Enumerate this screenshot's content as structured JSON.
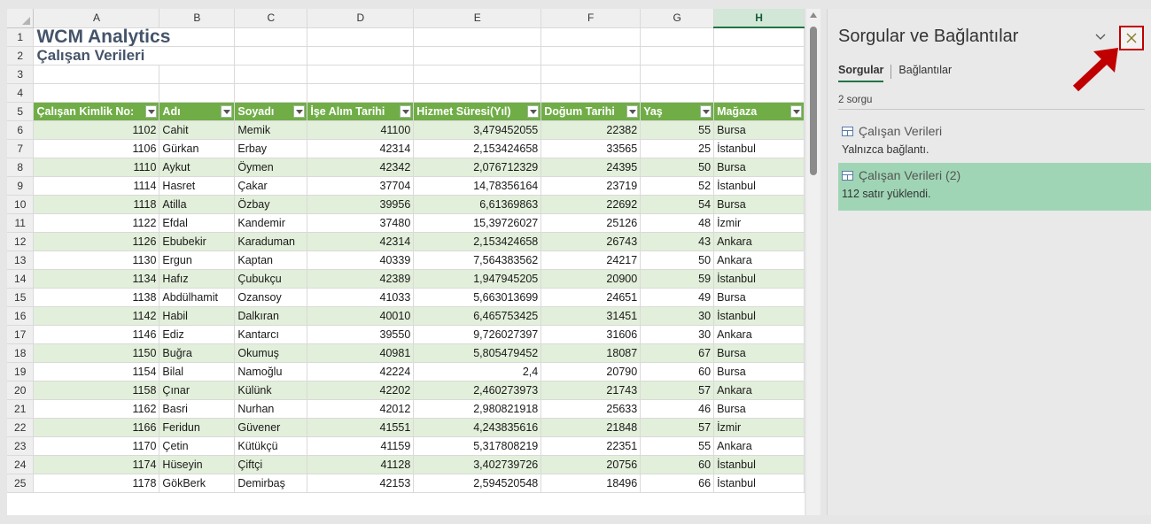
{
  "sheet": {
    "columns": [
      "A",
      "B",
      "C",
      "D",
      "E",
      "F",
      "G",
      "H"
    ],
    "selected_column": "H",
    "title": "WCM Analytics",
    "subtitle": "Çalışan Verileri",
    "headers": [
      "Çalışan Kimlik No:",
      "Adı",
      "Soyadı",
      "İşe Alım Tarihi",
      "Hizmet Süresi(Yıl)",
      "Doğum Tarihi",
      "Yaş",
      "Mağaza"
    ],
    "rows": [
      {
        "n": "6",
        "cells": [
          "1102",
          "Cahit",
          "Memik",
          "41100",
          "3,479452055",
          "22382",
          "55",
          "Bursa"
        ]
      },
      {
        "n": "7",
        "cells": [
          "1106",
          "Gürkan",
          "Erbay",
          "42314",
          "2,153424658",
          "33565",
          "25",
          "İstanbul"
        ]
      },
      {
        "n": "8",
        "cells": [
          "1110",
          "Aykut",
          "Öymen",
          "42342",
          "2,076712329",
          "24395",
          "50",
          "Bursa"
        ]
      },
      {
        "n": "9",
        "cells": [
          "1114",
          "Hasret",
          "Çakar",
          "37704",
          "14,78356164",
          "23719",
          "52",
          "İstanbul"
        ]
      },
      {
        "n": "10",
        "cells": [
          "1118",
          "Atilla",
          "Özbay",
          "39956",
          "6,61369863",
          "22692",
          "54",
          "Bursa"
        ]
      },
      {
        "n": "11",
        "cells": [
          "1122",
          "Efdal",
          "Kandemir",
          "37480",
          "15,39726027",
          "25126",
          "48",
          "İzmir"
        ]
      },
      {
        "n": "12",
        "cells": [
          "1126",
          "Ebubekir",
          "Karaduman",
          "42314",
          "2,153424658",
          "26743",
          "43",
          "Ankara"
        ]
      },
      {
        "n": "13",
        "cells": [
          "1130",
          "Ergun",
          "Kaptan",
          "40339",
          "7,564383562",
          "24217",
          "50",
          "Ankara"
        ]
      },
      {
        "n": "14",
        "cells": [
          "1134",
          "Hafız",
          "Çubukçu",
          "42389",
          "1,947945205",
          "20900",
          "59",
          "İstanbul"
        ]
      },
      {
        "n": "15",
        "cells": [
          "1138",
          "Abdülhamit",
          "Ozansoy",
          "41033",
          "5,663013699",
          "24651",
          "49",
          "Bursa"
        ]
      },
      {
        "n": "16",
        "cells": [
          "1142",
          "Habil",
          "Dalkıran",
          "40010",
          "6,465753425",
          "31451",
          "30",
          "İstanbul"
        ]
      },
      {
        "n": "17",
        "cells": [
          "1146",
          "Ediz",
          "Kantarcı",
          "39550",
          "9,726027397",
          "31606",
          "30",
          "Ankara"
        ]
      },
      {
        "n": "18",
        "cells": [
          "1150",
          "Buğra",
          "Okumuş",
          "40981",
          "5,805479452",
          "18087",
          "67",
          "Bursa"
        ]
      },
      {
        "n": "19",
        "cells": [
          "1154",
          "Bilal",
          "Namoğlu",
          "42224",
          "2,4",
          "20790",
          "60",
          "Bursa"
        ]
      },
      {
        "n": "20",
        "cells": [
          "1158",
          "Çınar",
          "Külünk",
          "42202",
          "2,460273973",
          "21743",
          "57",
          "Ankara"
        ]
      },
      {
        "n": "21",
        "cells": [
          "1162",
          "Basri",
          "Nurhan",
          "42012",
          "2,980821918",
          "25633",
          "46",
          "Bursa"
        ]
      },
      {
        "n": "22",
        "cells": [
          "1166",
          "Feridun",
          "Güvener",
          "41551",
          "4,243835616",
          "21848",
          "57",
          "İzmir"
        ]
      },
      {
        "n": "23",
        "cells": [
          "1170",
          "Çetin",
          "Kütükçü",
          "41159",
          "5,317808219",
          "22351",
          "55",
          "Ankara"
        ]
      },
      {
        "n": "24",
        "cells": [
          "1174",
          "Hüseyin",
          "Çiftçi",
          "41128",
          "3,402739726",
          "20756",
          "60",
          "İstanbul"
        ]
      },
      {
        "n": "25",
        "cells": [
          "1178",
          "GökBerk",
          "Demirbaş",
          "42153",
          "2,594520548",
          "18496",
          "66",
          "İstanbul"
        ]
      }
    ]
  },
  "pane": {
    "title": "Sorgular ve Bağlantılar",
    "tab_queries": "Sorgular",
    "tab_connections": "Bağlantılar",
    "query_count": "2 sorgu",
    "queries": [
      {
        "name": "Çalışan Verileri",
        "status": "Yalnızca bağlantı."
      },
      {
        "name": "Çalışan Verileri (2)",
        "status": "112 satır yüklendi."
      }
    ]
  },
  "colors": {
    "header_green": "#70ad47",
    "band_green": "#e2efda",
    "selected_query": "#9fd5b5",
    "annotation_red": "#c00000"
  }
}
